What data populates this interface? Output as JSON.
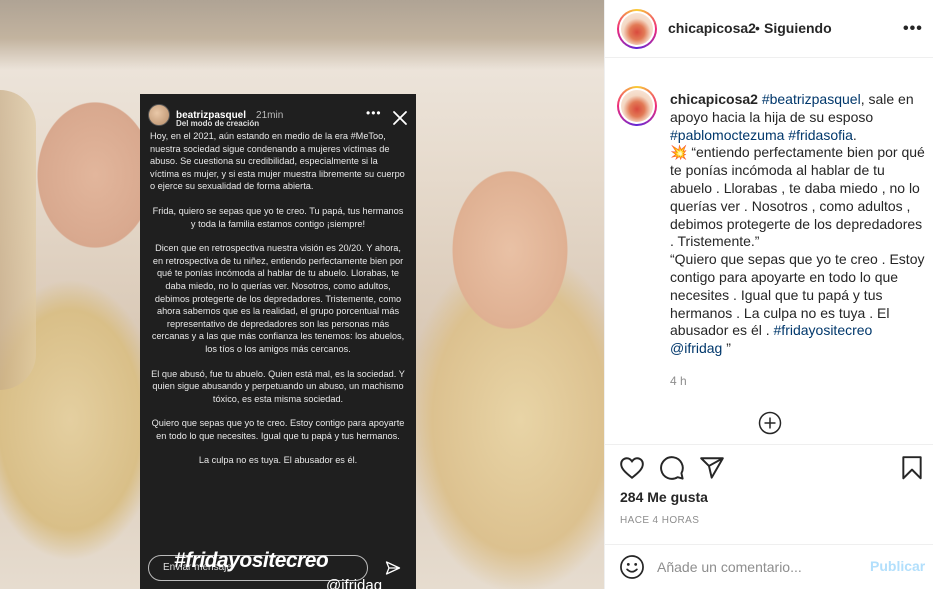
{
  "post": {
    "username": "chicapicosa2",
    "separator": "•",
    "follow_status": "Siguiendo",
    "more_icon": "more-horizontal-icon",
    "caption": {
      "username": "chicapicosa2",
      "mention1": "#beatrizpasquel",
      "text1": ", sale en apoyo hacia la hija de su esposo ",
      "tag1": "#pablomoctezuma",
      "space1": " ",
      "tag2": "#fridasofia",
      "text2": ".",
      "emoji": "💥",
      "quote1": " “entiendo perfectamente bien por qué te ponías incómoda al hablar de tu abuelo . Llorabas , te daba miedo , no lo querías ver . Nosotros , como adultos , debimos protegerte de los depredadores . Tristemente.”",
      "quote2": "“Quiero que sepas que yo te creo . Estoy contigo para apoyarte en todo lo que necesites . Igual que tu papá y tus hermanos . La culpa no es tuya . El abusador es él . ",
      "tag3": "#fridayositecreo",
      "mention2": "@ifridag",
      "end": " ”",
      "time": "4 h"
    },
    "likes": "284 Me gusta",
    "ago": "HACE 4 HORAS",
    "comment_placeholder": "Añade un comentario...",
    "publish_label": "Publicar"
  },
  "story": {
    "username": "beatrizpasquel",
    "time": "21min",
    "subtitle": "Del modo de creación",
    "paragraphs": [
      "Hoy, en el 2021, aún estando en medio de la era #MeToo, nuestra sociedad sigue condenando a mujeres víctimas de abuso. Se cuestiona su credibilidad, especialmente si la víctima es mujer, y si esta mujer muestra libremente su cuerpo o ejerce su sexualidad de forma abierta.",
      "Frida, quiero se sepas que yo te creo. Tu papá, tus hermanos y toda la familia estamos contigo ¡siempre!",
      "Dicen que en retrospectiva nuestra visión es 20/20. Y ahora, en retrospectiva de tu niñez, entiendo perfectamente bien por qué te ponías incómoda al hablar de tu abuelo. Llorabas, te daba miedo, no lo querías ver. Nosotros, como adultos, debimos protegerte de los depredadores. Tristemente, como ahora sabemos que es la realidad, el grupo porcentual más representativo de depredadores son las personas más cercanas y a las que más confianza les tenemos: los abuelos, los tíos o los amigos más cercanos.",
      "El que abusó, fue tu abuelo. Quien está mal, es la sociedad. Y quien sigue abusando y perpetuando un abuso, un machismo tóxico, es esta misma sociedad.",
      "Quiero que sepas que yo te creo. Estoy contigo para apoyarte en todo lo que necesites. Igual que tu papá y tus hermanos.",
      "La culpa no es tuya. El abusador es él."
    ],
    "hashtag": "#fridayositecreo",
    "handle": "@ifridag",
    "reply_placeholder": "Enviar mensaje"
  },
  "colors": {
    "link": "#00376b",
    "muted": "#8e8e8e",
    "publish_disabled": "#b2dffc",
    "story_bg": "#1f1f1f"
  },
  "icons": [
    "heart-icon",
    "comment-icon",
    "share-icon",
    "bookmark-icon",
    "emoji-icon",
    "plus-circle-icon",
    "close-icon",
    "send-icon"
  ]
}
